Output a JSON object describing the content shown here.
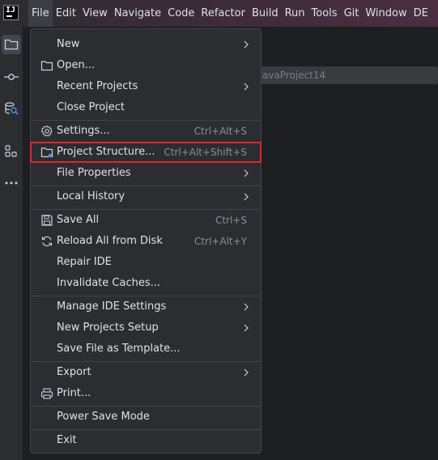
{
  "menubar": {
    "items": [
      "File",
      "Edit",
      "View",
      "Navigate",
      "Code",
      "Refactor",
      "Build",
      "Run",
      "Tools",
      "Git",
      "Window",
      "DE"
    ]
  },
  "background": {
    "project_field": "avaProject14"
  },
  "file_menu": {
    "items": [
      {
        "label": "New",
        "shortcut": "",
        "submenu": true,
        "icon": ""
      },
      {
        "label": "Open...",
        "shortcut": "",
        "submenu": false,
        "icon": "folder-icon"
      },
      {
        "label": "Recent Projects",
        "shortcut": "",
        "submenu": true,
        "icon": ""
      },
      {
        "label": "Close Project",
        "shortcut": "",
        "submenu": false,
        "icon": ""
      },
      {
        "label": "Settings...",
        "shortcut": "Ctrl+Alt+S",
        "submenu": false,
        "icon": "gear-icon"
      },
      {
        "label": "Project Structure...",
        "shortcut": "Ctrl+Alt+Shift+S",
        "submenu": false,
        "icon": "project-structure-icon",
        "highlighted": true
      },
      {
        "label": "File Properties",
        "shortcut": "",
        "submenu": true,
        "icon": ""
      },
      {
        "label": "Local History",
        "shortcut": "",
        "submenu": true,
        "icon": ""
      },
      {
        "label": "Save All",
        "shortcut": "Ctrl+S",
        "submenu": false,
        "icon": "save-icon"
      },
      {
        "label": "Reload All from Disk",
        "shortcut": "Ctrl+Alt+Y",
        "submenu": false,
        "icon": "reload-icon"
      },
      {
        "label": "Repair IDE",
        "shortcut": "",
        "submenu": false,
        "icon": ""
      },
      {
        "label": "Invalidate Caches...",
        "shortcut": "",
        "submenu": false,
        "icon": ""
      },
      {
        "label": "Manage IDE Settings",
        "shortcut": "",
        "submenu": true,
        "icon": ""
      },
      {
        "label": "New Projects Setup",
        "shortcut": "",
        "submenu": true,
        "icon": ""
      },
      {
        "label": "Save File as Template...",
        "shortcut": "",
        "submenu": false,
        "icon": ""
      },
      {
        "label": "Export",
        "shortcut": "",
        "submenu": true,
        "icon": ""
      },
      {
        "label": "Print...",
        "shortcut": "",
        "submenu": false,
        "icon": "print-icon"
      },
      {
        "label": "Power Save Mode",
        "shortcut": "",
        "submenu": false,
        "icon": ""
      },
      {
        "label": "Exit",
        "shortcut": "",
        "submenu": false,
        "icon": ""
      }
    ]
  },
  "colors": {
    "highlight_border": "#e0262c",
    "menu_bg": "#2b2d30"
  }
}
